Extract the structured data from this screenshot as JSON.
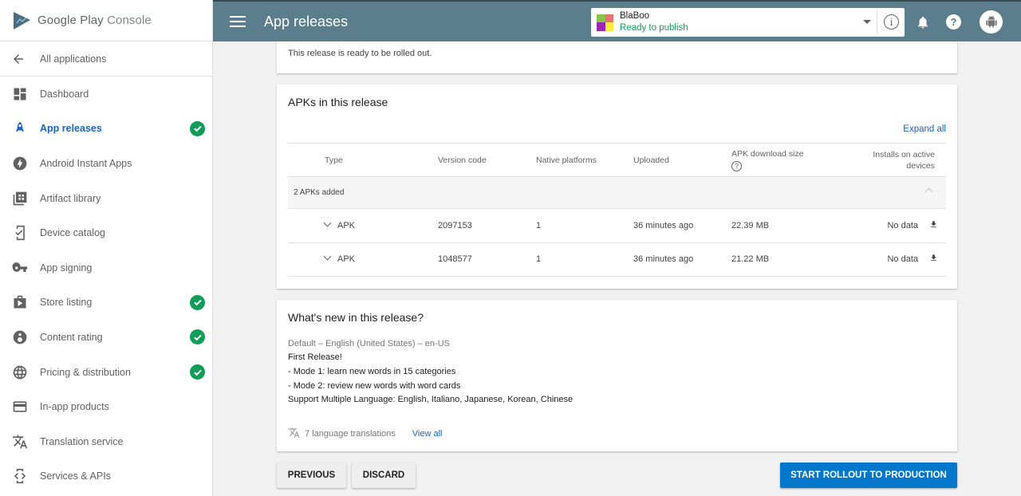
{
  "sidebar": {
    "logo_bold": "Google Play",
    "logo_light": "Console",
    "back_label": "All applications",
    "items": [
      {
        "label": "Dashboard",
        "icon": "dashboard-icon",
        "checked": false,
        "active": false
      },
      {
        "label": "App releases",
        "icon": "rocket-icon",
        "checked": true,
        "active": true
      },
      {
        "label": "Android Instant Apps",
        "icon": "bolt-icon",
        "checked": false,
        "active": false
      },
      {
        "label": "Artifact library",
        "icon": "library-icon",
        "checked": false,
        "active": false
      },
      {
        "label": "Device catalog",
        "icon": "device-check-icon",
        "checked": false,
        "active": false
      },
      {
        "label": "App signing",
        "icon": "key-icon",
        "checked": false,
        "active": false
      },
      {
        "label": "Store listing",
        "icon": "store-icon",
        "checked": true,
        "active": false
      },
      {
        "label": "Content rating",
        "icon": "content-rating-icon",
        "checked": true,
        "active": false
      },
      {
        "label": "Pricing & distribution",
        "icon": "globe-icon",
        "checked": true,
        "active": false
      },
      {
        "label": "In-app products",
        "icon": "credit-card-icon",
        "checked": false,
        "active": false
      },
      {
        "label": "Translation service",
        "icon": "translate-icon",
        "checked": false,
        "active": false
      },
      {
        "label": "Services & APIs",
        "icon": "api-icon",
        "checked": false,
        "active": false
      }
    ]
  },
  "topbar": {
    "title": "App releases",
    "app_name": "BlaBoo",
    "app_status": "Ready to publish",
    "info_glyph": "i",
    "help_glyph": "?"
  },
  "status_card": {
    "message": "This release is ready to be rolled out."
  },
  "apks_card": {
    "title": "APKs in this release",
    "expand_all": "Expand all",
    "columns": [
      "Type",
      "Version code",
      "Native platforms",
      "Uploaded",
      "APK download size",
      "Installs on active devices"
    ],
    "group_label": "2 APKs added",
    "rows": [
      {
        "type": "APK",
        "version_code": "2097153",
        "native_platforms": "1",
        "uploaded": "36 minutes ago",
        "size": "22.39 MB",
        "installs": "No data"
      },
      {
        "type": "APK",
        "version_code": "1048577",
        "native_platforms": "1",
        "uploaded": "36 minutes ago",
        "size": "21.22 MB",
        "installs": "No data"
      }
    ]
  },
  "whats_new": {
    "title": "What's new in this release?",
    "language": "Default – English (United States) – en-US",
    "lines": [
      "First Release!",
      "- Mode 1: learn new words in 15 categories",
      "- Mode 2: review new words with word cards",
      "Support Multiple Language: English, Italiano, Japanese, Korean, Chinese"
    ],
    "translations": "7 language translations",
    "view_all": "View all"
  },
  "actions": {
    "previous": "PREVIOUS",
    "discard": "DISCARD",
    "rollout": "START ROLLOUT TO PRODUCTION"
  },
  "colors": {
    "topbar": "#5c7e8c",
    "accent": "#1565c0",
    "success": "#0f9d58",
    "primary_button": "#0277cc"
  }
}
